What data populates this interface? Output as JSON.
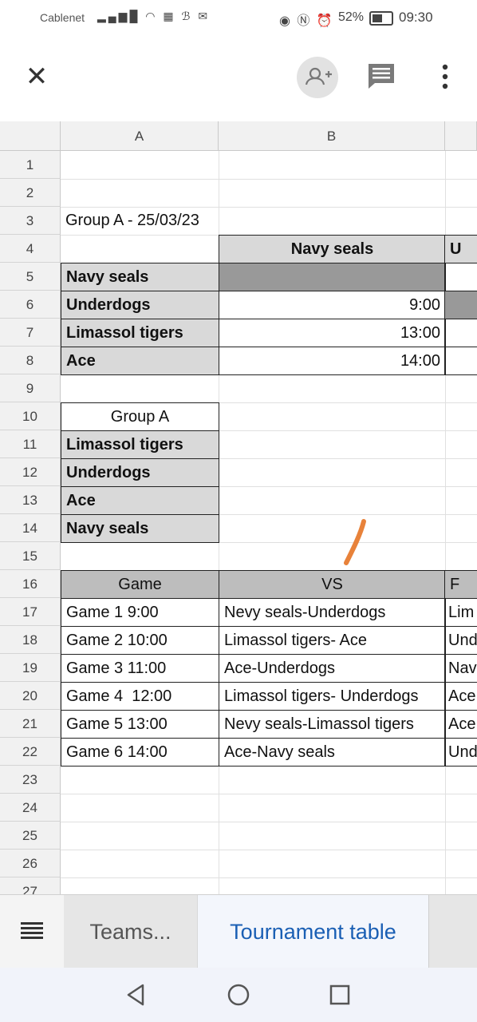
{
  "status": {
    "carrier": "Cablenet",
    "battery": "52%",
    "time": "09:30"
  },
  "toolbar": {
    "close_label": "✕"
  },
  "columns": [
    {
      "label": "A"
    },
    {
      "label": "B"
    }
  ],
  "rows": [
    "1",
    "2",
    "3",
    "4",
    "5",
    "6",
    "7",
    "8",
    "9",
    "10",
    "11",
    "12",
    "13",
    "14",
    "15",
    "16",
    "17",
    "18",
    "19",
    "20",
    "21",
    "22",
    "23",
    "24",
    "25",
    "26",
    "27"
  ],
  "cells": {
    "a3": "Group A - 25/03/23",
    "b4": "Navy seals",
    "c4": "U",
    "a5": "Navy seals",
    "a6": "Underdogs",
    "a7": "Limassol tigers",
    "a8": "Ace",
    "b6": "9:00",
    "b7": "13:00",
    "b8": "14:00",
    "a10": "Group A",
    "a11": "Limassol tigers",
    "a12": "Underdogs",
    "a13": "Ace",
    "a14": "Navy seals",
    "a16": "Game",
    "b16": "VS",
    "c16": "F"
  },
  "games": [
    {
      "game": "Game 1 9:00",
      "vs": "Nevy seals-Underdogs",
      "next": "Lim"
    },
    {
      "game": "Game 2 10:00",
      "vs": "Limassol tigers- Ace",
      "next": "Und"
    },
    {
      "game": "Game 3 11:00",
      "vs": "Ace-Underdogs",
      "next": "Nav"
    },
    {
      "game": "Game 4  12:00",
      "vs": "Limassol tigers- Underdogs",
      "next": "Ace"
    },
    {
      "game": "Game 5 13:00",
      "vs": "Nevy seals-Limassol tigers",
      "next": "Ace"
    },
    {
      "game": "Game 6 14:00",
      "vs": "Ace-Navy seals",
      "next": "Und"
    }
  ],
  "tabs": {
    "teams": "Teams...",
    "tournament": "Tournament table"
  },
  "colors": {
    "accent": "#1a5fb4",
    "cursor": "#e8823a"
  }
}
